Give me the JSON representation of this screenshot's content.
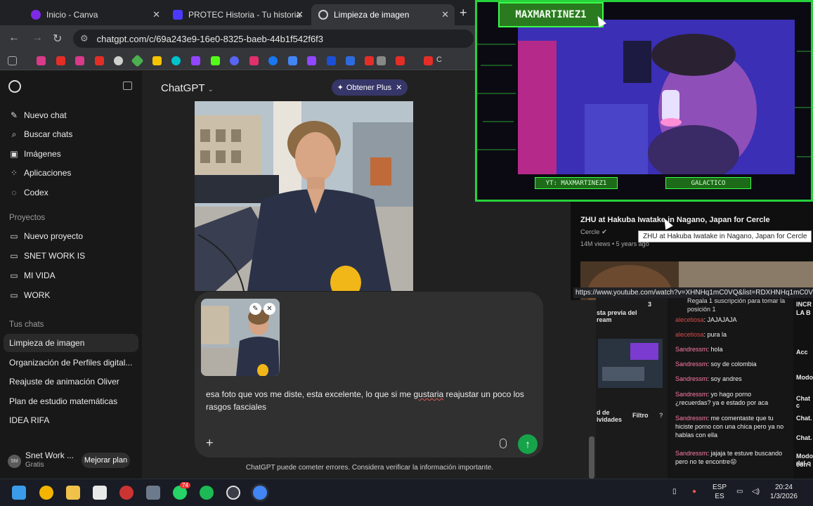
{
  "browser": {
    "tabs": [
      {
        "label": "Inicio - Canva",
        "favicon_color": "#7d2ae8"
      },
      {
        "label": "PROTEC Historia - Tu historia",
        "favicon_color": "#4a3aff"
      },
      {
        "label": "Limpieza de imagen",
        "favicon_color": "#cfcfcf"
      }
    ],
    "url": "chatgpt.com/c/69a243e9-16e0-8325-baeb-44b1f542f6f3",
    "bookmark_letter": "C"
  },
  "sidebar": {
    "items": [
      {
        "label": "Nuevo chat",
        "icon": "edit-icon"
      },
      {
        "label": "Buscar chats",
        "icon": "search-icon"
      },
      {
        "label": "Imágenes",
        "icon": "image-icon"
      },
      {
        "label": "Aplicaciones",
        "icon": "apps-icon"
      },
      {
        "label": "Codex",
        "icon": "codex-icon"
      }
    ],
    "projects_heading": "Proyectos",
    "projects": [
      "Nuevo proyecto",
      "SNET WORK IS",
      "MI VIDA",
      "WORK"
    ],
    "chats_heading": "Tus chats",
    "chats": [
      "Limpieza de imagen",
      "Organización de Perfiles digital...",
      "Reajuste de animación Oliver",
      "Plan de estudio matemáticas",
      "IDEA RIFA"
    ],
    "user": {
      "initials": "SM",
      "name": "Snet Work ...",
      "plan": "Gratis",
      "upgrade_label": "Mejorar plan"
    }
  },
  "main": {
    "model": "ChatGPT",
    "plus_label": "Obtener Plus",
    "composer_text_a": "esa foto que vos me diste, esta excelente, lo que si me ",
    "composer_text_misspelled": "gustaria",
    "composer_text_b": " reajustar un poco los rasgos fasciales",
    "disclaimer": "ChatGPT puede cometer errores. Considera verificar la información importante."
  },
  "stream": {
    "streamer": "MAXMARTINEZ1",
    "badge_left": "YT: MAXMARTINEZ1",
    "badge_right": "GALACTICO"
  },
  "youtube": {
    "title": "ZHU at Hakuba Iwatake in Nagano, Japan for Cercle",
    "channel": "Cercle",
    "meta": "14M views • 5 years ago",
    "tooltip": "ZHU at Hakuba Iwatake in Nagano, Japan for Cercle",
    "status_url": "https://www.youtube.com/watch?v=XHNHq1mC0VQ&list=RDXHNHq1mC0VQ"
  },
  "obs": {
    "left_labels": [
      "sta previa del",
      "ream",
      "d de",
      "ividades"
    ],
    "filter_label": "Filtro",
    "top_note": "Regala 1 suscripción para tomar la posición 1",
    "number": "3",
    "messages": [
      {
        "user": "alecetiosa",
        "text": "JAJAJAJA"
      },
      {
        "user": "alecetiosa",
        "text": "pura la"
      },
      {
        "user": "Sandressm",
        "text": "hola"
      },
      {
        "user": "Sandressm",
        "text": "soy de colombia"
      },
      {
        "user": "Sandressm",
        "text": "soy andres"
      },
      {
        "user": "Sandressm",
        "text": "yo hago porno ¿recuerdas? ya e estado por aca"
      },
      {
        "user": "Sandressm",
        "text": "me comentaste que tu hiciste porno con una chica pero ya no hablas con ella"
      },
      {
        "user": "Sandressm",
        "text": "jajaja te estuve buscando pero no te encontre😜"
      }
    ],
    "right_labels": [
      "INCR",
      "LA B",
      "Acc",
      "Modo",
      "Chat c",
      "Chat.",
      "Chat.",
      "Modo del c",
      "con l"
    ]
  },
  "taskbar": {
    "whatsapp_badge": "74",
    "lang": "ESP",
    "lang2": "ES",
    "time": "20:24",
    "date": "1/3/2026"
  }
}
